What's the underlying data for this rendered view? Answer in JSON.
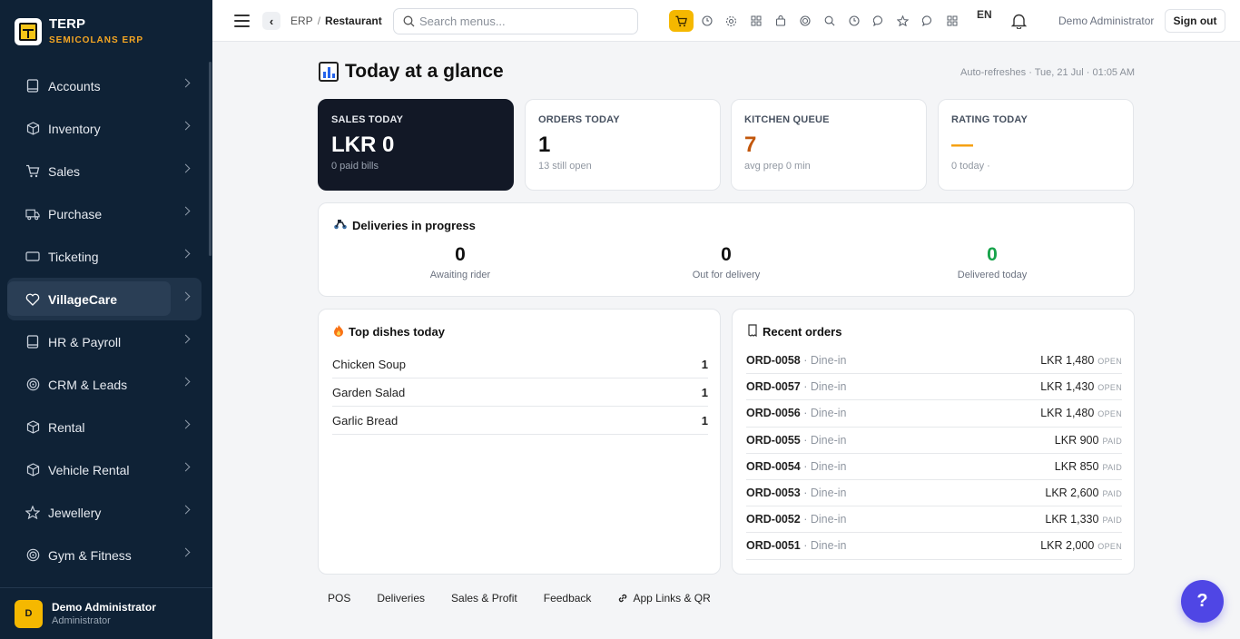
{
  "brand": {
    "name": "TERP",
    "subtitle": "SEMICOLANS ERP"
  },
  "sidebar": {
    "items": [
      {
        "label": "Accounts",
        "icon": "book-icon"
      },
      {
        "label": "Inventory",
        "icon": "box-icon"
      },
      {
        "label": "Sales",
        "icon": "cart-icon"
      },
      {
        "label": "Purchase",
        "icon": "truck-icon"
      },
      {
        "label": "Ticketing",
        "icon": "ticket-icon"
      },
      {
        "label": "VillageCare",
        "icon": "heart-icon",
        "active": true
      },
      {
        "label": "HR & Payroll",
        "icon": "book-icon"
      },
      {
        "label": "CRM & Leads",
        "icon": "target-icon"
      },
      {
        "label": "Rental",
        "icon": "box-icon"
      },
      {
        "label": "Vehicle Rental",
        "icon": "box-icon"
      },
      {
        "label": "Jewellery",
        "icon": "star-icon"
      },
      {
        "label": "Gym & Fitness",
        "icon": "target-icon"
      }
    ],
    "user": {
      "initial": "D",
      "name": "Demo Administrator",
      "role": "Administrator"
    }
  },
  "topbar": {
    "breadcrumb": [
      "ERP",
      "Restaurant"
    ],
    "search_placeholder": "Search menus...",
    "lang": "EN",
    "admin_name": "Demo Administrator",
    "signout_label": "Sign out"
  },
  "header": {
    "title": "Today at a glance",
    "refresh_text": "Auto-refreshes · Tue, 21 Jul · 01:05 AM"
  },
  "kpis": [
    {
      "label": "SALES TODAY",
      "value": "LKR 0",
      "sub": "0 paid bills"
    },
    {
      "label": "ORDERS TODAY",
      "value": "1",
      "sub": "13 still open"
    },
    {
      "label": "KITCHEN QUEUE",
      "value": "7",
      "sub": "avg prep 0 min"
    },
    {
      "label": "RATING TODAY",
      "value": "—",
      "sub": "0 today ·"
    }
  ],
  "deliveries": {
    "title": "Deliveries in progress",
    "stats": [
      {
        "value": "0",
        "label": "Awaiting rider"
      },
      {
        "value": "0",
        "label": "Out for delivery"
      },
      {
        "value": "0",
        "label": "Delivered today"
      }
    ]
  },
  "top_dishes": {
    "title": "Top dishes today",
    "rows": [
      {
        "name": "Chicken Soup",
        "qty": "1"
      },
      {
        "name": "Garden Salad",
        "qty": "1"
      },
      {
        "name": "Garlic Bread",
        "qty": "1"
      }
    ]
  },
  "recent_orders": {
    "title": "Recent orders",
    "rows": [
      {
        "id": "ORD-0058",
        "type": " · Dine-in",
        "amount": "LKR 1,480",
        "status": "OPEN"
      },
      {
        "id": "ORD-0057",
        "type": " · Dine-in",
        "amount": "LKR 1,430",
        "status": "OPEN"
      },
      {
        "id": "ORD-0056",
        "type": " · Dine-in",
        "amount": "LKR 1,480",
        "status": "OPEN"
      },
      {
        "id": "ORD-0055",
        "type": " · Dine-in",
        "amount": "LKR 900",
        "status": "PAID"
      },
      {
        "id": "ORD-0054",
        "type": " · Dine-in",
        "amount": "LKR 850",
        "status": "PAID"
      },
      {
        "id": "ORD-0053",
        "type": " · Dine-in",
        "amount": "LKR 2,600",
        "status": "PAID"
      },
      {
        "id": "ORD-0052",
        "type": " · Dine-in",
        "amount": "LKR 1,330",
        "status": "PAID"
      },
      {
        "id": "ORD-0051",
        "type": " · Dine-in",
        "amount": "LKR 2,000",
        "status": "OPEN"
      }
    ]
  },
  "quick_links": [
    "POS",
    "Deliveries",
    "Sales & Profit",
    "Feedback",
    "App Links & QR"
  ],
  "help_label": "?",
  "colors": {
    "sidebar_bg": "#0f2236",
    "accent": "#f5b800",
    "help": "#4f46e5",
    "kitchen": "#c2570c",
    "delivered": "#16a34a"
  }
}
